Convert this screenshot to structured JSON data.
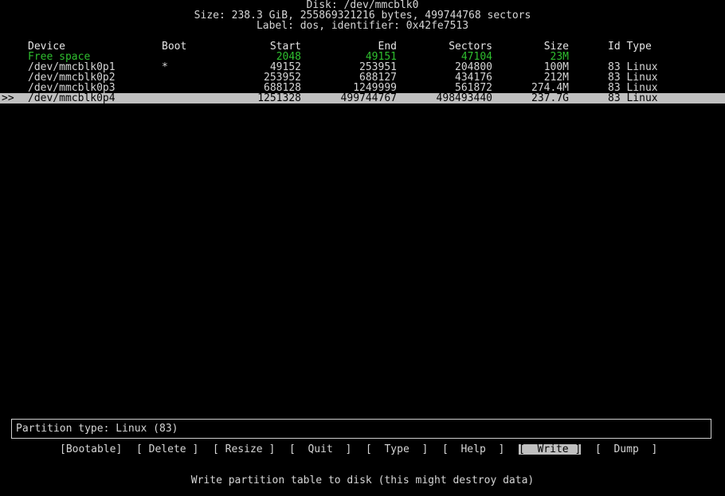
{
  "disk": {
    "title": "Disk: /dev/mmcblk0",
    "size_line": "Size: 238.3 GiB, 255869321216 bytes, 499744768 sectors",
    "label_line": "Label: dos, identifier: 0x42fe7513"
  },
  "columns": {
    "device": "Device",
    "boot": "Boot",
    "start": "Start",
    "end": "End",
    "sectors": "Sectors",
    "size": "Size",
    "id_type": "Id Type"
  },
  "rows": [
    {
      "marker": "",
      "device": "Free space",
      "boot": "",
      "start": "2048",
      "end": "49151",
      "sectors": "47104",
      "size": "23M",
      "id_type": ""
    },
    {
      "marker": "",
      "device": "/dev/mmcblk0p1",
      "boot": "*",
      "start": "49152",
      "end": "253951",
      "sectors": "204800",
      "size": "100M",
      "id_type": "83 Linux"
    },
    {
      "marker": "",
      "device": "/dev/mmcblk0p2",
      "boot": "",
      "start": "253952",
      "end": "688127",
      "sectors": "434176",
      "size": "212M",
      "id_type": "83 Linux"
    },
    {
      "marker": "",
      "device": "/dev/mmcblk0p3",
      "boot": "",
      "start": "688128",
      "end": "1249999",
      "sectors": "561872",
      "size": "274.4M",
      "id_type": "83 Linux"
    },
    {
      "marker": ">>",
      "device": "/dev/mmcblk0p4",
      "boot": "",
      "start": "1251328",
      "end": "499744767",
      "sectors": "498493440",
      "size": "237.7G",
      "id_type": "83 Linux"
    }
  ],
  "info": "Partition type: Linux (83)",
  "menu": {
    "bootable": "[Bootable]",
    "delete": "[ Delete ]",
    "resize": "[ Resize ]",
    "quit": "[  Quit  ]",
    "type": "[  Type  ]",
    "help": "[  Help  ]",
    "write": "[  Write ]",
    "dump": "[  Dump  ]"
  },
  "hint": "Write partition table to disk (this might destroy data)",
  "colors": {
    "free_space": "#2fbf2f",
    "selection_bg": "#c0c0c0",
    "background": "#000000"
  }
}
